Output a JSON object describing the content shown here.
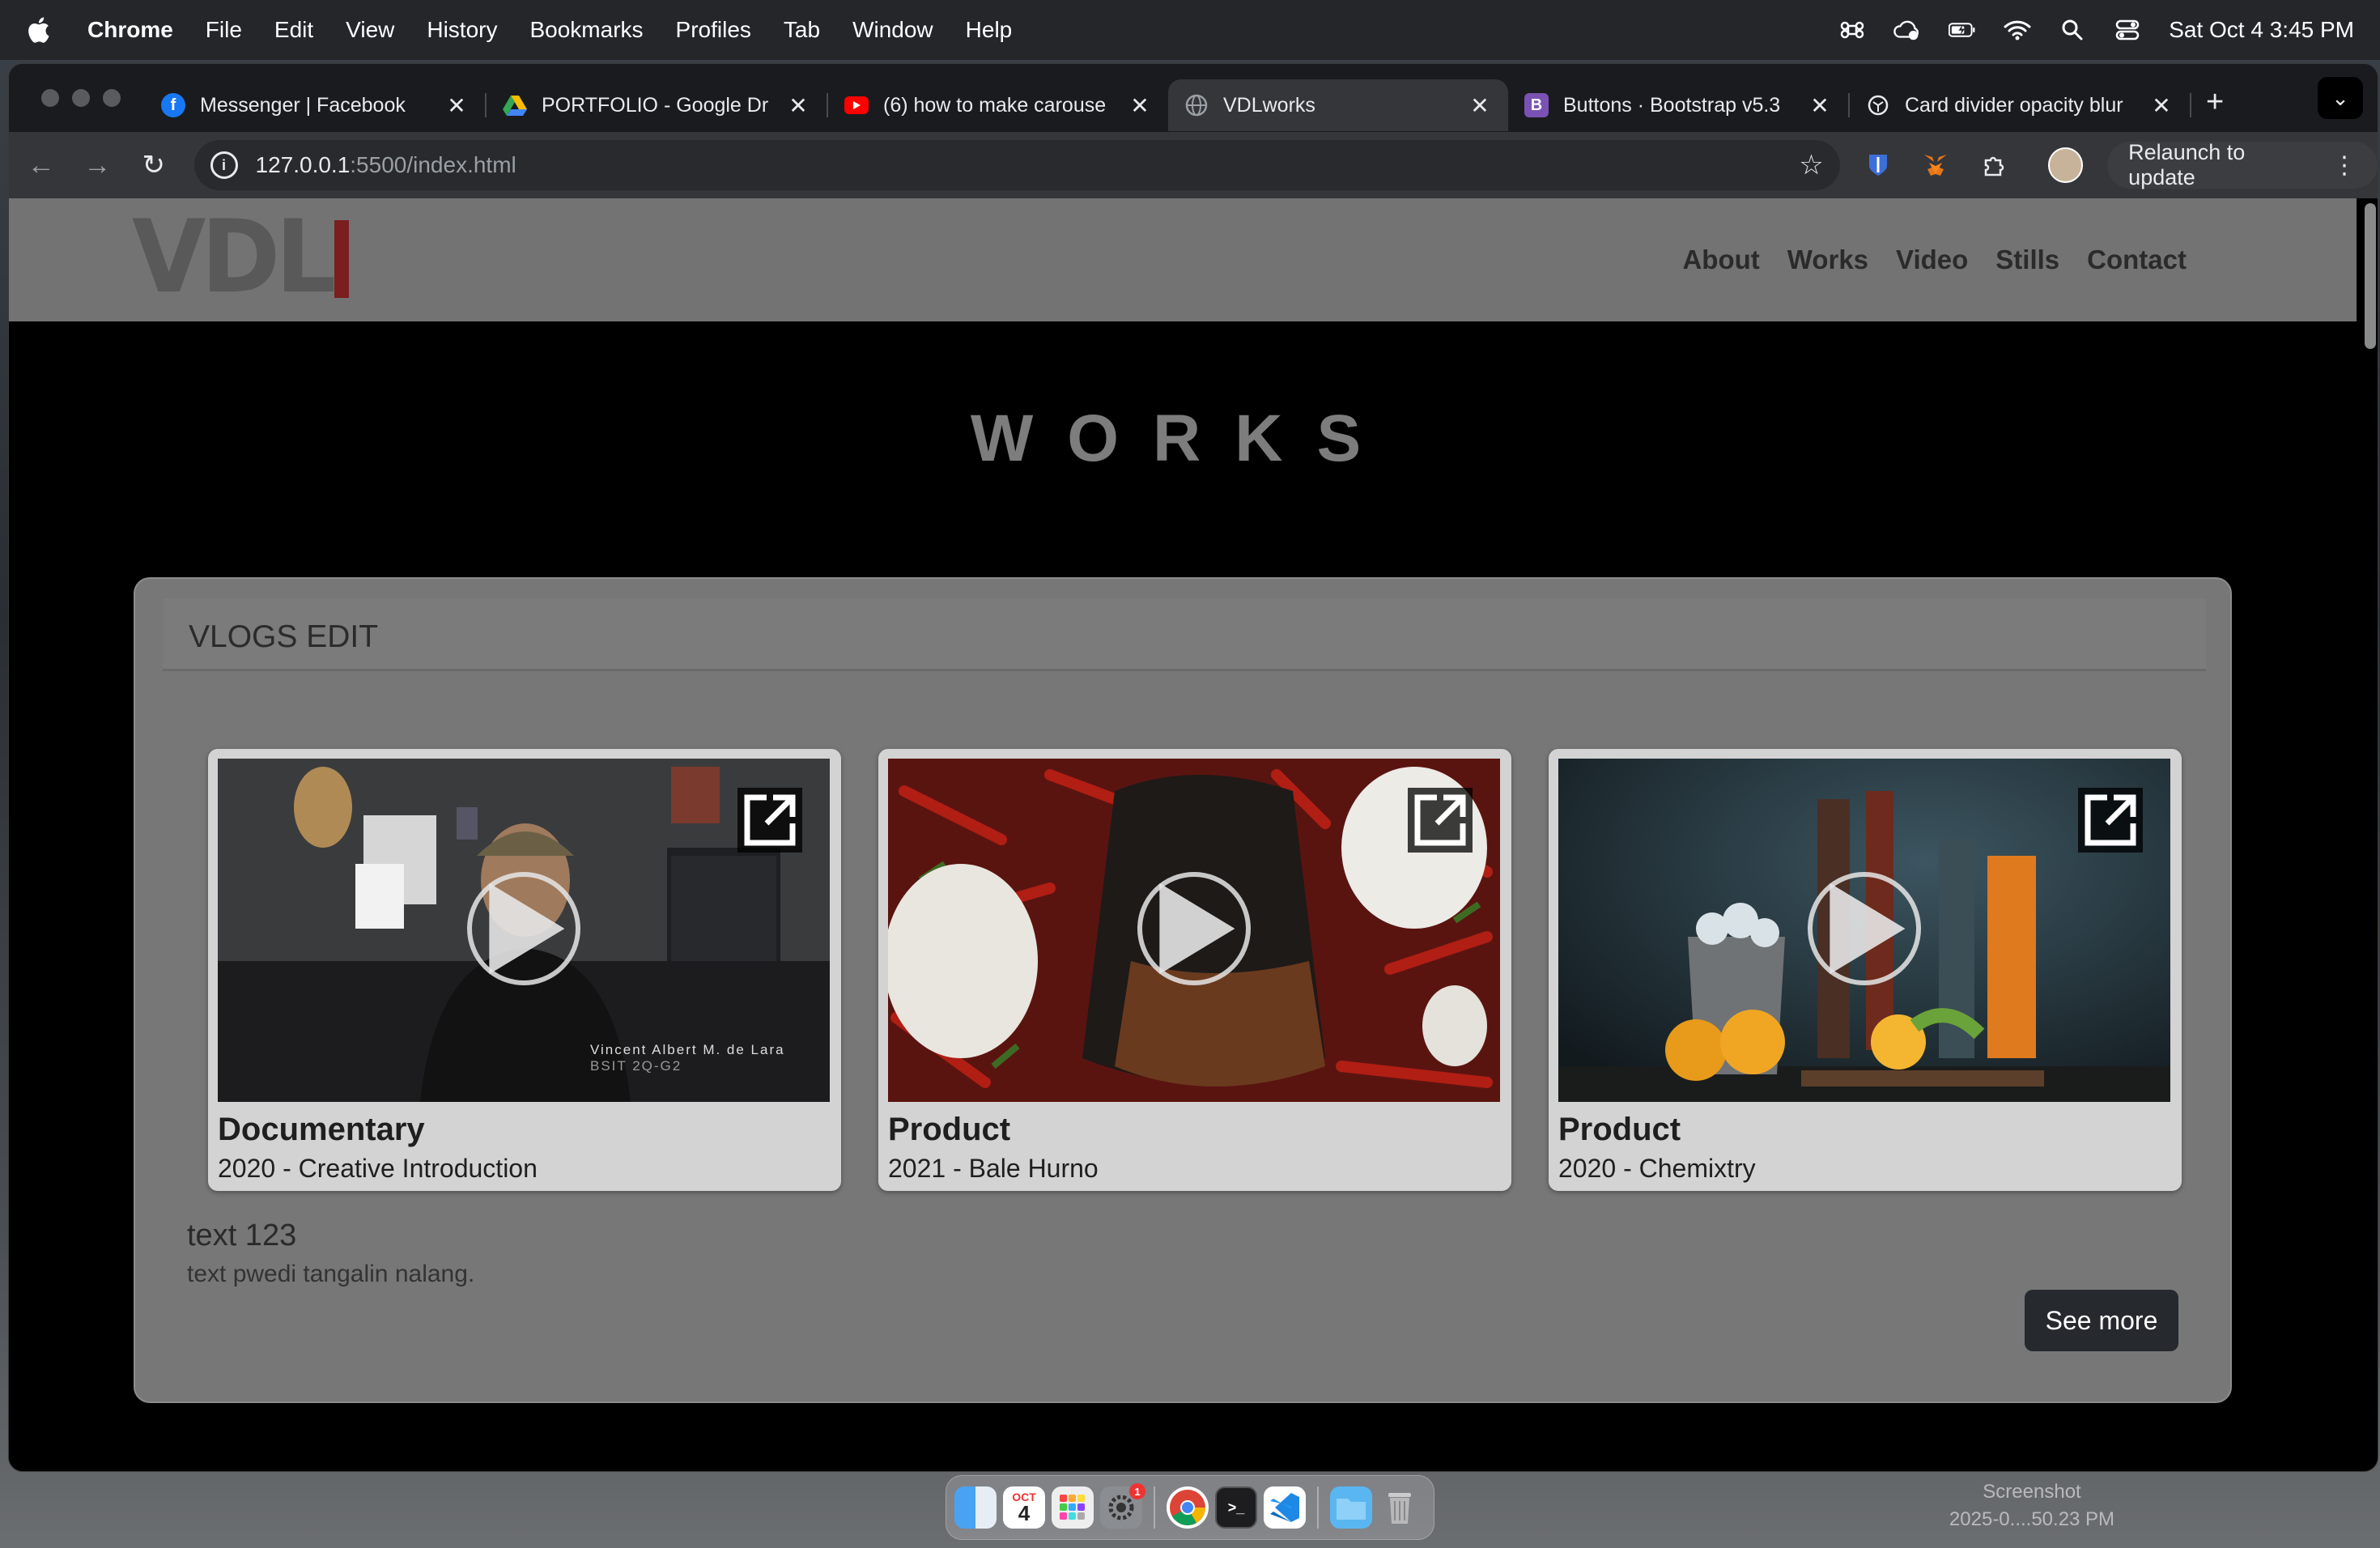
{
  "menubar": {
    "app_name": "Chrome",
    "items": [
      "File",
      "Edit",
      "View",
      "History",
      "Bookmarks",
      "Profiles",
      "Tab",
      "Window",
      "Help"
    ],
    "clock": "Sat Oct 4  3:45 PM"
  },
  "tabs": [
    {
      "title": "Messenger | Facebook",
      "icon": "facebook-icon",
      "color": "#1877f2",
      "active": false
    },
    {
      "title": "PORTFOLIO - Google Dr",
      "icon": "google-drive-icon",
      "color": "#34a853",
      "active": false
    },
    {
      "title": "(6) how to make carouse",
      "icon": "youtube-icon",
      "color": "#ff0000",
      "active": false
    },
    {
      "title": "VDLworks",
      "icon": "globe-icon",
      "color": "#9aa0a6",
      "active": true
    },
    {
      "title": "Buttons · Bootstrap v5.3",
      "icon": "bootstrap-icon",
      "color": "#7952b3",
      "active": false
    },
    {
      "title": "Card divider opacity blur",
      "icon": "chatgpt-icon",
      "color": "#e8eaed",
      "active": false
    }
  ],
  "address": {
    "host": "127.0.0.1",
    "path": ":5500/index.html"
  },
  "toolbar": {
    "relaunch_label": "Relaunch to update"
  },
  "site": {
    "logo": "VDL",
    "nav": [
      "About",
      "Works",
      "Video",
      "Stills",
      "Contact"
    ],
    "heading": "WORKS",
    "panel_title": "VLOGS EDIT",
    "cards": [
      {
        "title": "Documentary",
        "subtitle": "2020 - Creative Introduction",
        "overlay": "Vincent Albert M. de Lara",
        "overlay2": "BSIT 2Q-G2"
      },
      {
        "title": "Product",
        "subtitle": "2021 - Bale Hurno"
      },
      {
        "title": "Product",
        "subtitle": "2020 - Chemixtry"
      }
    ],
    "text_title": "text 123",
    "text_body": "text pwedi tangalin nalang.",
    "see_more": "See more"
  },
  "dock": {
    "calendar_month": "OCT",
    "calendar_day": "4",
    "badge": "1"
  },
  "screenshot_label": [
    "Screenshot",
    "2025-0....50.23 PM"
  ]
}
